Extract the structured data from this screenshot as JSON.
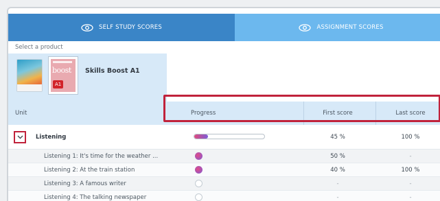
{
  "tabs": [
    {
      "label": "SELF STUDY SCORES",
      "icon": "eye-icon",
      "active": true
    },
    {
      "label": "ASSIGNMENT SCORES",
      "icon": "eye-icon",
      "active": false
    }
  ],
  "product_selector": {
    "label": "Select a product",
    "products": [
      {
        "name": "",
        "cover": "book-cover-icon"
      },
      {
        "name": "Skills Boost A1",
        "cover": "skills-boost-a1-cover",
        "cover_text": "boost",
        "cover_level": "A1",
        "selected": true
      }
    ]
  },
  "table": {
    "headers": {
      "unit": "Unit",
      "progress": "Progress",
      "first_score": "First score",
      "last_score": "Last score"
    },
    "section": {
      "title": "Listening",
      "progress": 0.2,
      "first_score": "45 %",
      "last_score": "100 %",
      "expanded": true
    },
    "rows": [
      {
        "name": "Listening 1: It's time for the weather ...",
        "done": true,
        "first_score": "50 %",
        "last_score": "-"
      },
      {
        "name": "Listening 2: At the train station",
        "done": true,
        "first_score": "40 %",
        "last_score": "100 %"
      },
      {
        "name": "Listening 3: A famous writer",
        "done": false,
        "first_score": "-",
        "last_score": "-"
      },
      {
        "name": "Listening 4: The talking newspaper",
        "done": false,
        "first_score": "-",
        "last_score": "-"
      }
    ]
  },
  "colors": {
    "tab_active": "#3a85c7",
    "tab_inactive": "#6cb8ee",
    "header_bg": "#d7e9f8",
    "highlight": "#c0223b",
    "progress_fill_start": "#e04a7d",
    "progress_fill_end": "#7b5cd6"
  }
}
